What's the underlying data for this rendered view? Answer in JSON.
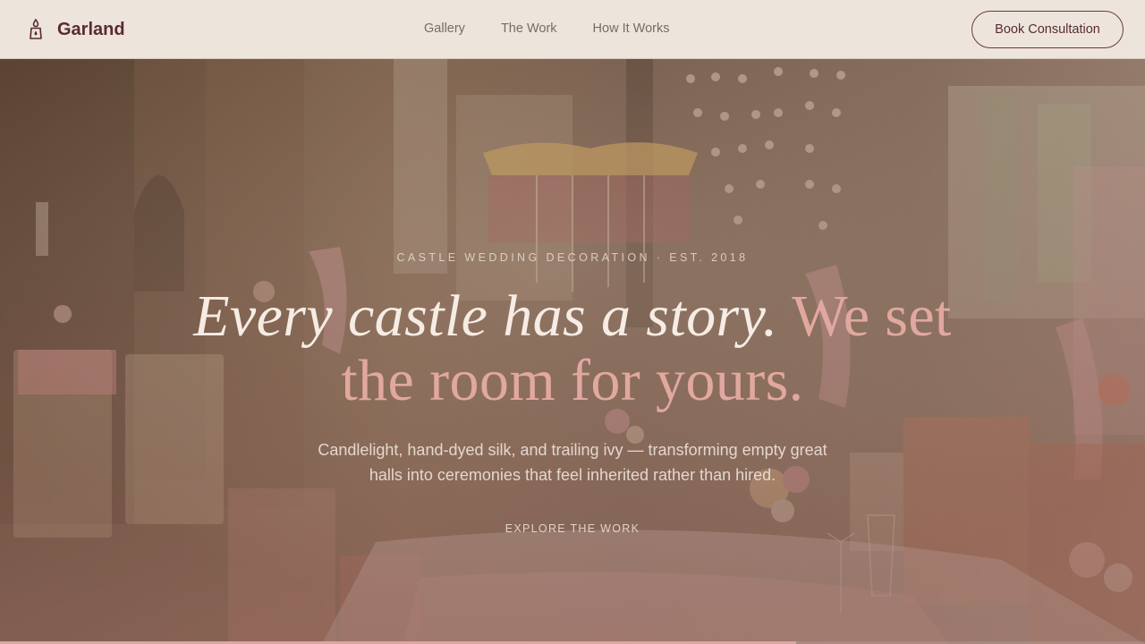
{
  "brand": {
    "name": "Garland",
    "icon": "candle-lantern-icon"
  },
  "nav": {
    "items": [
      "Gallery",
      "The Work",
      "How It Works"
    ]
  },
  "header": {
    "cta_label": "Book Consultation"
  },
  "hero": {
    "eyebrow": "CASTLE WEDDING DECORATION · EST. 2018",
    "headline_main": "Every castle has a story.",
    "headline_accent": "We set the room for yours.",
    "lede": "Candlelight, hand-dyed silk, and trailing ivy — transforming empty great halls into ceremonies that feel inherited rather than hired.",
    "explore_label": "EXPLORE THE WORK",
    "progress": 0.695
  },
  "colors": {
    "header_bg": "#ede5dc",
    "brand": "#5a2a33",
    "accent_pink": "#e1a8a0",
    "progress": "#d7a7a0"
  }
}
